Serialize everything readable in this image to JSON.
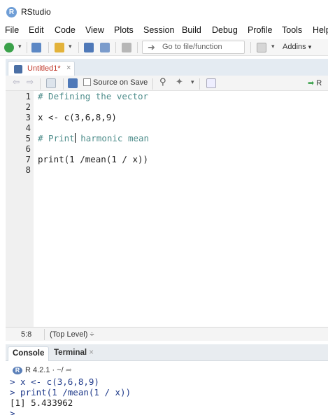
{
  "window": {
    "title": "RStudio",
    "logo_letter": "R"
  },
  "menu": [
    "File",
    "Edit",
    "Code",
    "View",
    "Plots",
    "Session",
    "Build",
    "Debug",
    "Profile",
    "Tools",
    "Help"
  ],
  "toolbar": {
    "goto_placeholder": "Go to file/function",
    "addins_label": "Addins"
  },
  "editor_tab": {
    "filename": "Untitled1*",
    "close": "×"
  },
  "editor_toolbar": {
    "source_on_save": "Source on Save",
    "run_partial": "R"
  },
  "editor": {
    "lines": [
      {
        "n": "1",
        "text": "# Defining the vector",
        "kind": "comment"
      },
      {
        "n": "2",
        "text": "",
        "kind": "blank"
      },
      {
        "n": "3",
        "text": "x <- c(3,6,8,9)",
        "kind": "code"
      },
      {
        "n": "4",
        "text": "",
        "kind": "blank"
      },
      {
        "n": "5a",
        "text": "# Print",
        "kind": "comment"
      },
      {
        "n": "5b",
        "text": " harmonic mean",
        "kind": "comment"
      },
      {
        "n": "6",
        "text": "",
        "kind": "blank"
      },
      {
        "n": "7",
        "text": "print(1 /mean(1 / x))",
        "kind": "code"
      },
      {
        "n": "8",
        "text": "",
        "kind": "blank"
      }
    ],
    "line_numbers": [
      "1",
      "2",
      "3",
      "4",
      "5",
      "6",
      "7",
      "8"
    ]
  },
  "status": {
    "position": "5:8",
    "scope": "(Top Level) ÷"
  },
  "console": {
    "tabs": [
      "Console",
      "Terminal"
    ],
    "terminal_close": "×",
    "version_line": "R 4.2.1 · ~/",
    "lines": [
      "> x <- c(3,6,8,9)",
      "> print(1 /mean(1 / x))",
      "[1] 5.433962",
      "> "
    ]
  },
  "colors": {
    "comment": "#4e8d8b",
    "console_input": "#1f3a8a",
    "r_blue": "#6f9ed6",
    "tab_modified": "#c0392b"
  }
}
